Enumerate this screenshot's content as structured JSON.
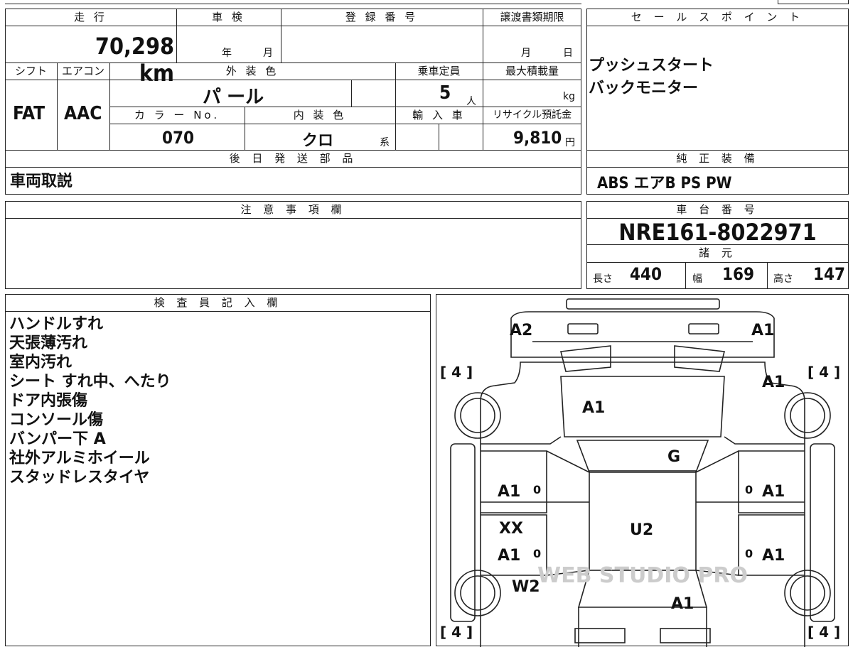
{
  "top_left": {
    "mileage_header": "走 行",
    "mileage_value": "70,298 km",
    "inspection_header": "車 検",
    "inspection_year": "年",
    "inspection_month": "月",
    "registration_header": "登 録 番 号",
    "transfer_header": "譲渡書類期限",
    "transfer_month": "月",
    "transfer_day": "日",
    "shift_header": "シフト",
    "shift_value": "FAT",
    "ac_header": "エアコン",
    "ac_value": "AAC",
    "exterior_header": "外 装 色",
    "exterior_value": "パ ール",
    "capacity_header": "乗車定員",
    "capacity_value": "5",
    "capacity_unit": "人",
    "load_header": "最大積載量",
    "load_unit": "kg",
    "color_no_header": "カ ラ ー No.",
    "color_no_value": "070",
    "interior_header": "内 装 色",
    "interior_value": "クロ",
    "interior_unit": "系",
    "import_header": "輸 入 車",
    "recycle_header": "リサイクル預託金",
    "recycle_value": "9,810",
    "recycle_unit": "円",
    "later_parts_header": "後 日 発 送 部 品",
    "later_parts_value": "車両取説"
  },
  "sales": {
    "header": "セ ー ル ス ポ イ ン ト",
    "points": [
      "プッシュスタート",
      "バックモニター"
    ]
  },
  "equipment": {
    "header": "純 正 装 備",
    "value": "ABS エアB PS PW"
  },
  "notes": {
    "header": "注 意 事 項 欄"
  },
  "chassis": {
    "header": "車 台 番 号",
    "value": "NRE161-8022971",
    "specs_header": "諸 元",
    "length_label": "長さ",
    "length_value": "440",
    "width_label": "幅",
    "width_value": "169",
    "height_label": "高さ",
    "height_value": "147"
  },
  "inspector": {
    "header": "検 査 員 記 入 欄",
    "lines": [
      "ハンドルすれ",
      "天張薄汚れ",
      "室内汚れ",
      "シート すれ中、へたり",
      "ドア内張傷",
      "コンソール傷",
      "バンパー下 A",
      "社外アルミホイール",
      "スタッドレスタイヤ"
    ]
  },
  "diagram": {
    "marks": {
      "front_left": "A2",
      "front_right": "A1",
      "hood": "A1",
      "right_fender": "A1",
      "windshield": "G",
      "left_front_door": "A1",
      "right_front_door": "A1",
      "left_rear_door_1": "XX",
      "left_rear_door_2": "A1",
      "right_rear_door": "A1",
      "roof": "U2",
      "left_rear_wheel": "W2",
      "rear": "A1"
    },
    "tire_labels": [
      "[ 4 ]",
      "[ 4 ]",
      "[ 4 ]",
      "[ 4 ]"
    ],
    "zeros": [
      "0",
      "0",
      "0",
      "0"
    ],
    "watermark": "WEB STUDIO PRO"
  }
}
